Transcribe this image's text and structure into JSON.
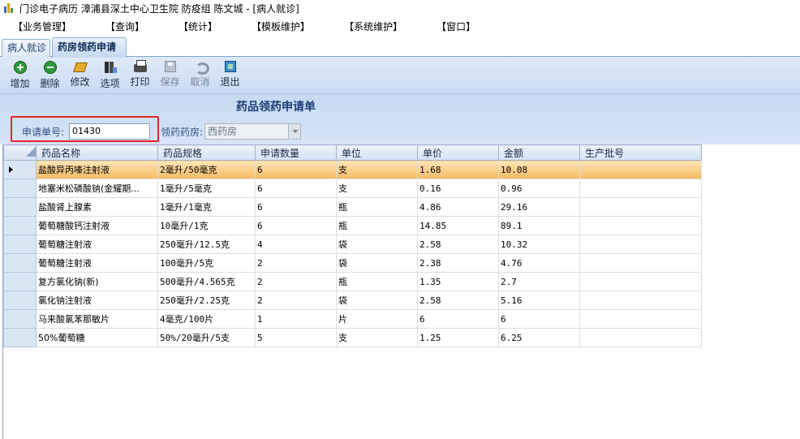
{
  "window": {
    "title": "门诊电子病历  漳浦县深土中心卫生院  防疫组  陈文城 - [病人就诊]"
  },
  "menu": [
    "【业务管理】",
    "【查询】",
    "【统计】",
    "【模板维护】",
    "【系统维护】",
    "【窗口】"
  ],
  "tabs": [
    "病人就诊",
    "药房领药申请"
  ],
  "toolbar": [
    "增加",
    "删除",
    "修改",
    "选项",
    "打印",
    "保存",
    "取消",
    "退出"
  ],
  "form": {
    "title": "药品领药申请单",
    "request_no_label": "申请单号:",
    "request_no_value": "01430",
    "pharmacy_label": "领药药房:",
    "pharmacy_value": "西药房"
  },
  "table": {
    "columns": [
      "药品名称",
      "药品规格",
      "申请数量",
      "单位",
      "单价",
      "金额",
      "生产批号"
    ],
    "rows": [
      [
        "盐酸异丙嗪注射液",
        "2毫升/50毫克",
        "6",
        "支",
        "1.68",
        "10.08",
        ""
      ],
      [
        "地塞米松磷酸钠(金耀期...",
        "1毫升/5毫克",
        "6",
        "支",
        "0.16",
        "0.96",
        ""
      ],
      [
        "盐酸肾上腺素",
        "1毫升/1毫克",
        "6",
        "瓶",
        "4.86",
        "29.16",
        ""
      ],
      [
        "葡萄糖酸钙注射液",
        "10毫升/1克",
        "6",
        "瓶",
        "14.85",
        "89.1",
        ""
      ],
      [
        "葡萄糖注射液",
        "250毫升/12.5克",
        "4",
        "袋",
        "2.58",
        "10.32",
        ""
      ],
      [
        "葡萄糖注射液",
        "100毫升/5克",
        "2",
        "袋",
        "2.38",
        "4.76",
        ""
      ],
      [
        "复方氯化钠(新)",
        "500毫升/4.565克",
        "2",
        "瓶",
        "1.35",
        "2.7",
        ""
      ],
      [
        "氯化钠注射液",
        "250毫升/2.25克",
        "2",
        "袋",
        "2.58",
        "5.16",
        ""
      ],
      [
        "马来酸氯苯那敏片",
        "4毫克/100片",
        "1",
        "片",
        "6",
        "6",
        ""
      ],
      [
        "50%葡萄糖",
        "50%/20毫升/5支",
        "5",
        "支",
        "1.25",
        "6.25",
        ""
      ]
    ],
    "selected_row": 0
  }
}
